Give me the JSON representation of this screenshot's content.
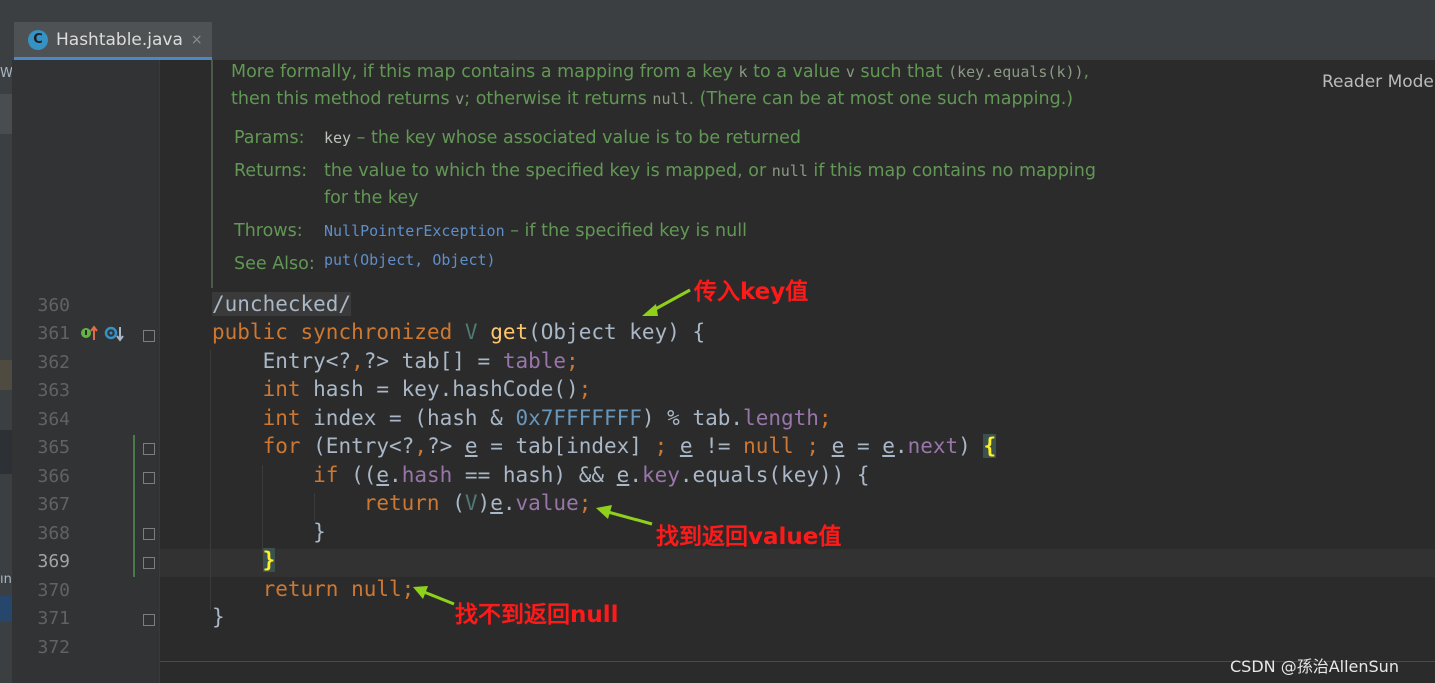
{
  "editor": {
    "tab": {
      "icon": "class-icon",
      "icon_letter": "C",
      "title": "Hashtable.java",
      "close": "×"
    },
    "reader_mode": "Reader Mode",
    "left_strip": [
      "W",
      "ın"
    ]
  },
  "doc": {
    "line1": {
      "t1": "More formally, if this map contains a mapping from a key ",
      "c1": "k",
      "t2": " to a value ",
      "c2": "v",
      "t3": " such that ",
      "c3": "(key.equals(k))",
      "t4": ","
    },
    "line2": {
      "t1": "then this method returns ",
      "c1": "v",
      "t2": "; otherwise it returns ",
      "c2": "null",
      "t3": ". (There can be at most one such mapping.)"
    },
    "params_label": "Params:",
    "params_key": "key",
    "params_text": " – the key whose associated value is to be returned",
    "returns_label": "Returns:",
    "returns_t1": "the value to which the specified key is mapped, or ",
    "returns_code": "null",
    "returns_t2": " if this map contains no mapping",
    "returns_t3": "for the key",
    "throws_label": "Throws:",
    "throws_link": "NullPointerException",
    "throws_text": " – if the specified key is null",
    "seealso_label": "See Also:",
    "seealso_link": "put(Object, Object)"
  },
  "line_numbers": [
    "360",
    "361",
    "362",
    "363",
    "364",
    "365",
    "366",
    "367",
    "368",
    "369",
    "370",
    "371",
    "372"
  ],
  "code": {
    "l360": "/unchecked/",
    "l361": {
      "public": "public",
      "synchronized": "synchronized",
      "v": "V",
      "get": "get",
      "rest": "(Object key) {"
    },
    "l362": {
      "a": "Entry<?",
      "comma": ",",
      "b": "?> tab[] = ",
      "table": "table",
      "semi": ";"
    },
    "l363": {
      "int": "int",
      "rest": " hash = key.hashCode()",
      "semi": ";"
    },
    "l364": {
      "int": "int",
      "a": " index = (hash & ",
      "hex": "0x7FFFFFFF",
      "b": ") % tab.",
      "length": "length",
      "semi": ";"
    },
    "l365": {
      "for": "for",
      "a": " (Entry<?",
      "comma": ",",
      "b": "?> ",
      "e": "e",
      "c": " = tab[index] ",
      "semi": ";",
      "d": " ",
      "e2": "e",
      "f": " != ",
      "null": "null",
      "semi2": " ;",
      "g": " ",
      "e3": "e",
      "h": " = ",
      "e4": "e",
      "dot": ".",
      "next": "next",
      "i": ") ",
      "brace": "{"
    },
    "l366": {
      "if": "if",
      "a": " ((",
      "e": "e",
      "dot": ".",
      "hash": "hash",
      "b": " == hash) && ",
      "e2": "e",
      "dot2": ".",
      "key": "key",
      "c": ".equals(key)) {"
    },
    "l367": {
      "return": "return",
      "a": " (",
      "v": "V",
      "b": ")",
      "e": "e",
      "dot": ".",
      "value": "value",
      "semi": ";"
    },
    "l368": "}",
    "l369": "}",
    "l370": {
      "return": "return",
      "null": "null",
      "semi": ";"
    },
    "l371": "}"
  },
  "annotations": {
    "a1": "传入key值",
    "a2": "找到返回value值",
    "a3": "找不到返回null"
  },
  "watermark": "CSDN @孫治AllenSun",
  "colors": {
    "background": "#2b2b2b",
    "keyword": "#cc7832",
    "field": "#9876aa",
    "number": "#6897bb",
    "method": "#ffc66d",
    "doc_text": "#629755",
    "annotation_text": "#ff1a1a",
    "arrow": "#8fd11a"
  }
}
